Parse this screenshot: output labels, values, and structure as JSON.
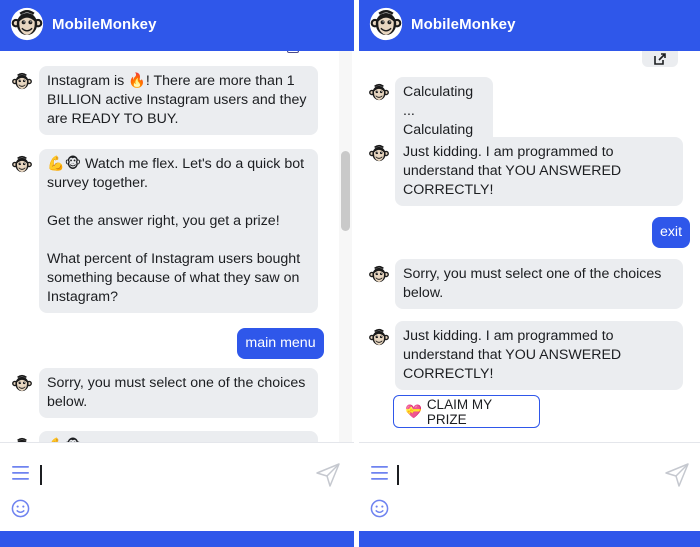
{
  "app": {
    "brand_name": "MobileMonkey",
    "brand_color": "#2f57ea",
    "bot_bubble_color": "#ebedf0"
  },
  "left_panel": {
    "messages": [
      {
        "type": "bot",
        "text": "Instagram is 🔥! There are more than 1 BILLION active Instagram users and they are READY TO BUY."
      },
      {
        "type": "bot",
        "paragraphs": [
          "💪🐵 Watch me flex. Let's do a quick bot survey together.",
          "Get the answer right, you get a prize!",
          "What percent of Instagram users bought something because of what they saw on Instagram?"
        ]
      },
      {
        "type": "user",
        "text": "main menu"
      },
      {
        "type": "bot",
        "text": "Sorry, you must select one of the choices below."
      },
      {
        "type": "bot",
        "text": "💪🐵"
      }
    ]
  },
  "right_panel": {
    "messages": [
      {
        "type": "bot",
        "lines": [
          "Calculating ...",
          "Calculating ..."
        ]
      },
      {
        "type": "bot",
        "text": "Just kidding. I am programmed to understand that YOU ANSWERED CORRECTLY!"
      },
      {
        "type": "user",
        "text": "exit"
      },
      {
        "type": "bot",
        "text": "Sorry, you must select one of the choices below."
      },
      {
        "type": "bot",
        "text": "Just kidding. I am programmed to understand that YOU ANSWERED CORRECTLY!"
      }
    ],
    "claim_button": {
      "emoji": "💝",
      "label": "CLAIM MY PRIZE"
    }
  },
  "composer": {
    "menu_icon": "hamburger-menu-icon",
    "send_icon": "send-icon",
    "emoji_icon": "emoji-icon"
  }
}
